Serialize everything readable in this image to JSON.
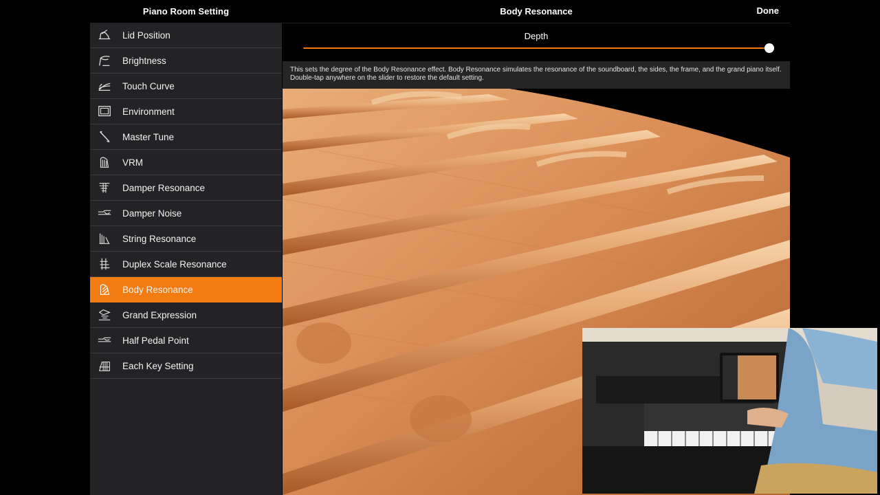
{
  "sidebar": {
    "title": "Piano Room Setting",
    "items": [
      {
        "label": "Lid Position",
        "icon": "lid-position-icon"
      },
      {
        "label": "Brightness",
        "icon": "brightness-icon"
      },
      {
        "label": "Touch Curve",
        "icon": "touch-curve-icon"
      },
      {
        "label": "Environment",
        "icon": "environment-icon"
      },
      {
        "label": "Master Tune",
        "icon": "master-tune-icon"
      },
      {
        "label": "VRM",
        "icon": "vrm-icon"
      },
      {
        "label": "Damper Resonance",
        "icon": "damper-resonance-icon"
      },
      {
        "label": "Damper Noise",
        "icon": "damper-noise-icon"
      },
      {
        "label": "String Resonance",
        "icon": "string-resonance-icon"
      },
      {
        "label": "Duplex Scale Resonance",
        "icon": "duplex-scale-icon"
      },
      {
        "label": "Body Resonance",
        "icon": "body-resonance-icon",
        "selected": true
      },
      {
        "label": "Grand Expression",
        "icon": "grand-expression-icon"
      },
      {
        "label": "Half Pedal Point",
        "icon": "half-pedal-icon"
      },
      {
        "label": "Each Key Setting",
        "icon": "each-key-icon"
      }
    ]
  },
  "main": {
    "title": "Body Resonance",
    "done_label": "Done",
    "parameter_label": "Depth",
    "slider_value": 1.0,
    "description": "This sets the degree of the Body Resonance effect. Body Resonance simulates the resonance of the soundboard, the sides, the frame, and the grand piano itself. Double-tap anywhere on the slider to restore the default setting."
  },
  "colors": {
    "accent": "#f27c12",
    "sidebar_bg": "#232326",
    "background": "#000000"
  }
}
